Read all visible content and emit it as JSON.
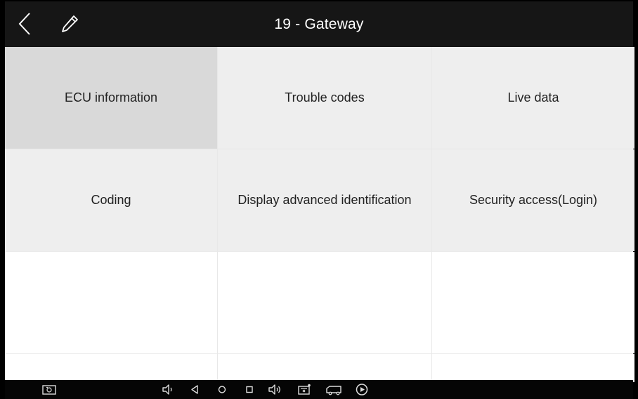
{
  "header": {
    "title": "19 - Gateway"
  },
  "menu": {
    "items": [
      {
        "label": "ECU information"
      },
      {
        "label": "Trouble codes"
      },
      {
        "label": "Live data"
      },
      {
        "label": "Coding"
      },
      {
        "label": "Display advanced identification"
      },
      {
        "label": "Security access(Login)"
      }
    ]
  },
  "colors": {
    "topbar": "#161616",
    "cell": "#eeeeee",
    "cell_selected": "#d9d9d9",
    "navbar": "#050505"
  },
  "navbar": {
    "icons": [
      "screenshot-icon",
      "volume-down-icon",
      "back-triangle-icon",
      "home-circle-icon",
      "recents-square-icon",
      "volume-up-icon",
      "vci-icon",
      "truck-icon",
      "play-circle-icon"
    ]
  }
}
